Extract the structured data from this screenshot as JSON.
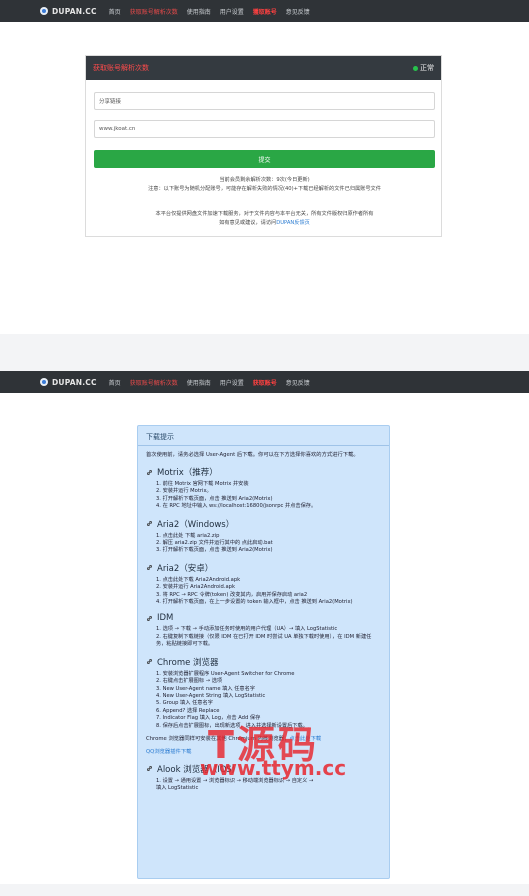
{
  "top_nav": {
    "logo": "DUPAN.CC",
    "items": [
      "首页",
      "获取账号解析次数",
      "使用指南",
      "用户设置",
      "獲取账号",
      "意见反馈"
    ]
  },
  "parse_card": {
    "title": "获取账号解析次数",
    "status": "正常",
    "link_input": "分享链接",
    "pwd_input": "www.jkoat.cn",
    "submit": "提交",
    "stats_line1": "当前会员剩余解析次数：9次(今日更新)",
    "stats_line2": "注意：以下账号为随机分配账号，可能存在解析失败的情况(40)+下载已经解析的文件已归属账号文件",
    "notice_line1": "本平台仅提供网盘文件加速下载服务，对于文件内容与本平台无关，所有文件版权归原作者所有",
    "notice_line2_prefix": "如有意见或建议，请访问",
    "notice_link": "DUPAN反馈页"
  },
  "bottom_nav": {
    "logo": "DUPAN.CC",
    "items": [
      "首页",
      "获取账号解析次数",
      "使用指南",
      "用户设置",
      "获取账号",
      "意见反馈"
    ]
  },
  "download_panel": {
    "header": "下载提示",
    "intro": "首次使用前，请务必选择 User-Agent 后下载。你可以在下方选择你喜欢的方式进行下载。",
    "sections": [
      {
        "title": "Motrix（推荐）",
        "steps": [
          "1. 前往 Motrix 官网下载 Motrix 并安装",
          "2. 安装并运行 Motrix。",
          "3. 打开解析下载页面，点击 推送到 Aria2(Motrix)",
          "4. 在 RPC 地址中输入 ws://localhost:16800/jsonrpc 并点击保存。"
        ]
      },
      {
        "title": "Aria2（Windows）",
        "steps": [
          "1. 点击此处 下载 aria2.zip",
          "2. 解压 aria2.zip 文件并运行其中的 点此启动.bat",
          "3. 打开解析下载页面，点击 推送到 Aria2(Motrix)"
        ]
      },
      {
        "title": "Aria2（安卓）",
        "steps": [
          "1. 点击此处下载 Aria2Android.apk",
          "2. 安装并运行 Aria2Android.apk",
          "3. 将 RPC → RPC 令牌(token) 改变其内，启用并保存启动 aria2",
          "4. 打开解析下载页面，在上一步设置的 token 输入框中，点击 推送到 Aria2(Motrix)"
        ]
      },
      {
        "title": "IDM",
        "steps": [
          "1. 选项 → 下载 → 手动添加任务时使用的用户代理（UA）→ 填入 LogStatistic",
          "2. 右键复制下载链接（仅限 IDM 在已打开 IDM 时尝试 UA 单独下载时使用），在 IDM 新建任务，粘贴链接即可下载。"
        ]
      },
      {
        "title": "Chrome 浏览器",
        "steps": [
          "1. 安装浏览器扩展程序 User-Agent Switcher for Chrome",
          "2. 右键点击扩展图标 → 选项",
          "3. New User-Agent name 填入 任意名字",
          "4. New User-Agent String 填入 LogStatistic",
          "5. Group 填入 任意名字",
          "6. Append? 选择 Replace",
          "7. Indicator Flag 填入 Log，点击 Add 保存",
          "8. 保存后点击扩展图标，出现新选项，进入并选择新设置后下载。"
        ]
      }
    ],
    "chrome_note_prefix": "Chrome 浏览器同样可安装在其他 Chromium 内核浏览器，",
    "chrome_note_link": "点击此处下载",
    "qq_note": "QQ浏览器插件下载",
    "alook": {
      "title": "Alook 浏览器（IOS）",
      "steps": [
        "1. 设置 → 通用设置 → 浏览器标识 → 移动端浏览器标识 → 自定义 →",
        "填入 LogStatistic"
      ]
    }
  },
  "watermark": {
    "line1": "T源码",
    "line2": "www.ttym.cc"
  },
  "colors": {
    "nav_bg": "#2f3337",
    "accent_red": "#ff4040",
    "success_green": "#2aa745",
    "panel_blue": "#cfe5fb",
    "link_blue": "#2a7bd1"
  }
}
